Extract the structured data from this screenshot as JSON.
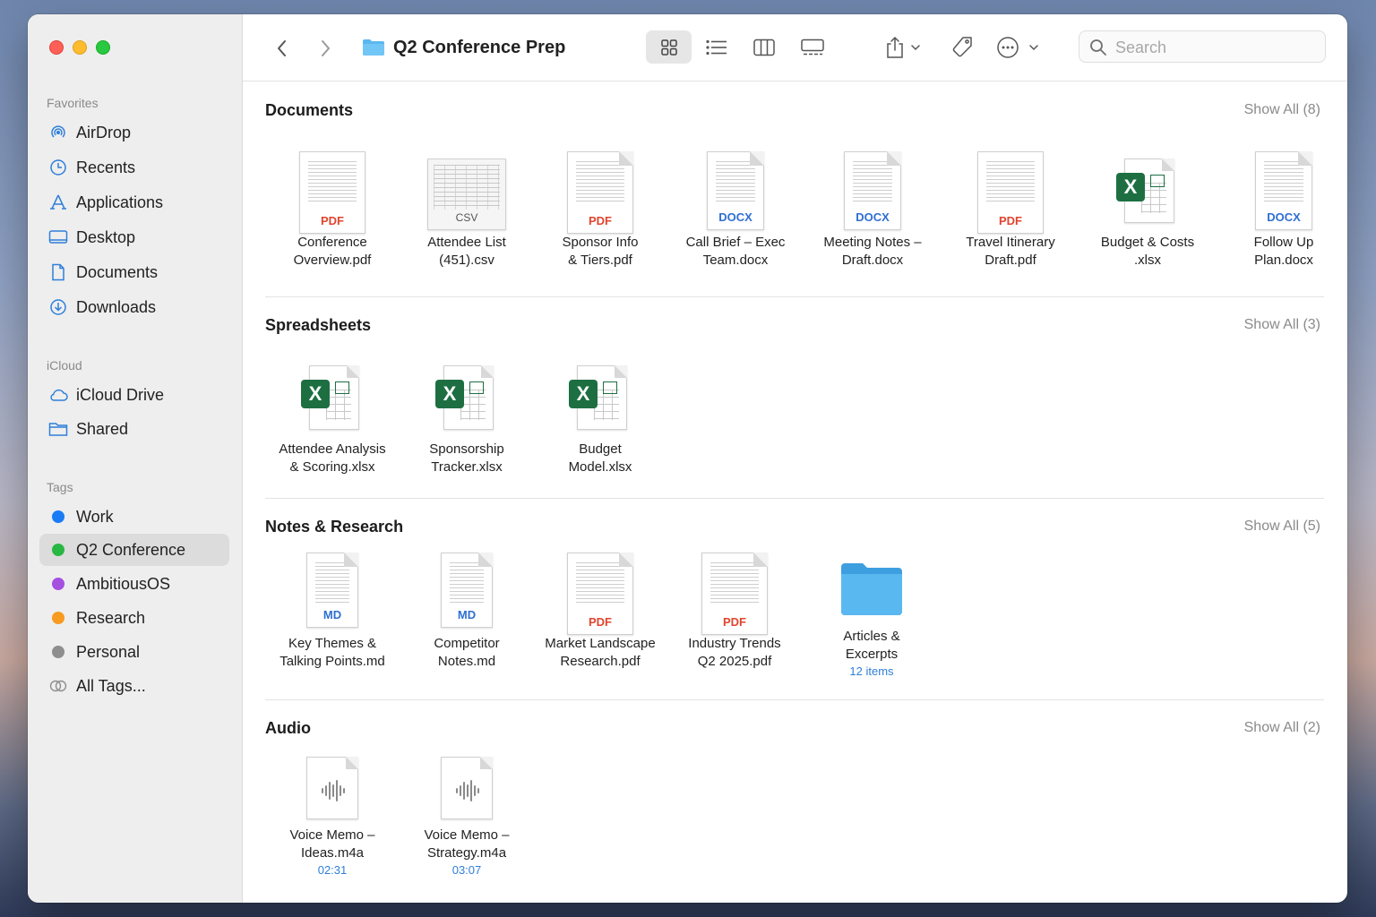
{
  "window": {
    "title": "Q2 Conference Prep"
  },
  "sidebar": {
    "favorites_heading": "Favorites",
    "favorites": [
      {
        "label": "AirDrop",
        "icon": "airdrop-icon"
      },
      {
        "label": "Recents",
        "icon": "clock-icon"
      },
      {
        "label": "Applications",
        "icon": "applications-icon"
      },
      {
        "label": "Desktop",
        "icon": "desktop-icon"
      },
      {
        "label": "Documents",
        "icon": "document-icon"
      },
      {
        "label": "Downloads",
        "icon": "download-icon"
      }
    ],
    "icloud_heading": "iCloud",
    "icloud": [
      {
        "label": "iCloud Drive",
        "icon": "cloud-icon"
      },
      {
        "label": "Shared",
        "icon": "shared-folder-icon"
      }
    ],
    "tags_heading": "Tags",
    "tags": [
      {
        "label": "Work",
        "color": "#1a7cf5"
      },
      {
        "label": "Q2 Conference",
        "color": "#29b744",
        "selected": true
      },
      {
        "label": "AmbitiousOS",
        "color": "#a550e0"
      },
      {
        "label": "Research",
        "color": "#f89a1f"
      },
      {
        "label": "Personal",
        "color": "#8e8e8e"
      },
      {
        "label": "All Tags...",
        "icon": "all-tags-icon"
      }
    ]
  },
  "toolbar": {
    "back_icon": "chevron-left-icon",
    "forward_icon": "chevron-right-icon",
    "folder_icon": "folder-icon",
    "views": [
      "icon-view",
      "list-view",
      "column-view",
      "gallery-view"
    ],
    "selected_view": "icon-view",
    "share_icon": "share-icon",
    "tag_icon": "tag-icon",
    "more_icon": "ellipsis-circle-icon",
    "search_placeholder": "Search"
  },
  "sections": {
    "documents": {
      "title": "Documents",
      "show_all": "Show All (8)",
      "files": [
        {
          "line1": "Conference",
          "line2": "Overview.pdf",
          "type": "PDF"
        },
        {
          "line1": "Attendee List",
          "line2": "(451).csv",
          "type": "CSV"
        },
        {
          "line1": "Sponsor Info",
          "line2": "& Tiers.pdf",
          "type": "PDF"
        },
        {
          "line1": "Call Brief – Exec",
          "line2": "Team.docx",
          "type": "DOCX"
        },
        {
          "line1": "Meeting Notes –",
          "line2": "Draft.docx",
          "type": "DOCX"
        },
        {
          "line1": "Travel Itinerary",
          "line2": "Draft.pdf",
          "type": "PDF"
        },
        {
          "line1": "Budget & Costs",
          "line2": ".xlsx",
          "type": "X"
        },
        {
          "line1": "Follow Up",
          "line2": "Plan.docx",
          "type": "DOCX"
        }
      ]
    },
    "spreadsheets": {
      "title": "Spreadsheets",
      "show_all": "Show All (3)",
      "files": [
        {
          "line1": "Attendee Analysis",
          "line2": "& Scoring.xlsx",
          "type": "X"
        },
        {
          "line1": "Sponsorship",
          "line2": "Tracker.xlsx",
          "type": "X"
        },
        {
          "line1": "Budget",
          "line2": "Model.xlsx",
          "type": "X"
        }
      ]
    },
    "notes": {
      "title": "Notes & Research",
      "show_all": "Show All (5)",
      "files": [
        {
          "line1": "Key Themes &",
          "line2": "Talking Points.md",
          "type": "MD"
        },
        {
          "line1": "Competitor",
          "line2": "Notes.md",
          "type": "MD"
        },
        {
          "line1": "Market Landscape",
          "line2": "Research.pdf",
          "type": "PDF"
        },
        {
          "line1": "Industry Trends",
          "line2": "Q2 2025.pdf",
          "type": "PDF"
        },
        {
          "line1": "Articles &",
          "line2": "Excerpts",
          "sub": "12 items",
          "type": "folder"
        }
      ]
    },
    "audio": {
      "title": "Audio",
      "show_all": "Show All (2)",
      "files": [
        {
          "line1": "Voice Memo –",
          "line2": "Ideas.m4a",
          "sub": "02:31",
          "type": "audio"
        },
        {
          "line1": "Voice Memo –",
          "line2": "Strategy.m4a",
          "sub": "03:07",
          "type": "audio"
        }
      ]
    }
  },
  "colors": {
    "pdf": "#e0452f",
    "docx": "#2e6fd3",
    "md": "#2e6fd3",
    "excel": "#1d6f42",
    "folder": "#5ab8f0",
    "link": "#2f7fd9"
  }
}
